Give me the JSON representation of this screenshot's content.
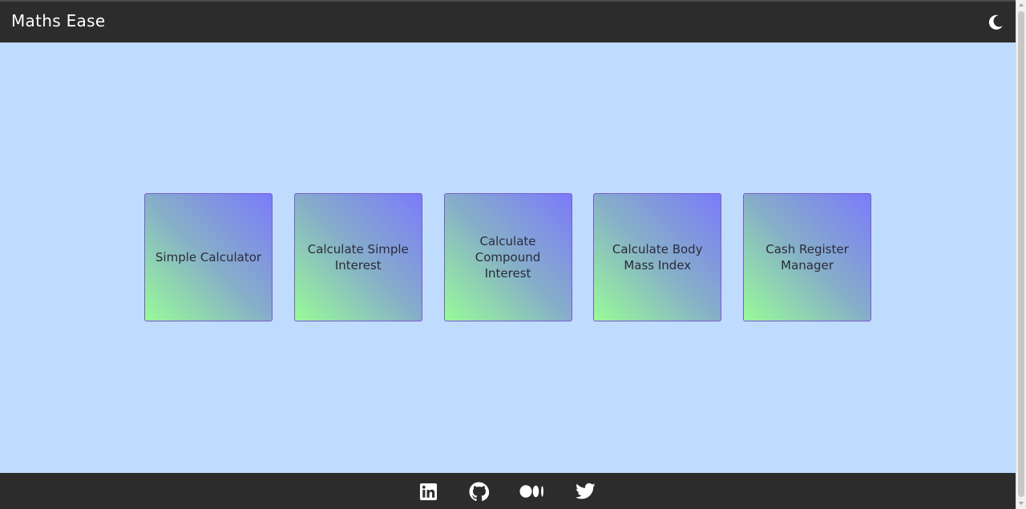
{
  "header": {
    "title": "Maths Ease",
    "theme_toggle_icon": "moon-icon"
  },
  "cards": [
    {
      "label": "Simple Calculator"
    },
    {
      "label": "Calculate Simple Interest"
    },
    {
      "label": "Calculate Compound Interest"
    },
    {
      "label": "Calculate Body Mass Index"
    },
    {
      "label": "Cash Register Manager"
    }
  ],
  "footer": {
    "links": [
      {
        "icon": "linkedin-icon"
      },
      {
        "icon": "github-icon"
      },
      {
        "icon": "medium-icon"
      },
      {
        "icon": "twitter-icon"
      }
    ]
  },
  "colors": {
    "background": "#bfdbfe",
    "bar": "#2c2c2c",
    "card_gradient_start": "#98fb98",
    "card_gradient_end": "#7b7bfa",
    "card_border": "#7c58d6"
  }
}
